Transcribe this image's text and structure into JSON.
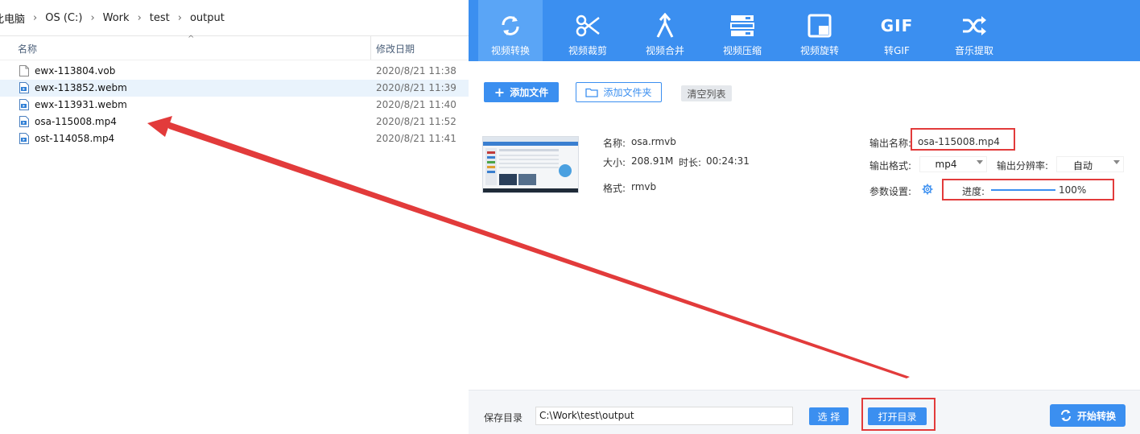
{
  "explorer": {
    "breadcrumb": [
      "此电脑",
      "OS (C:)",
      "Work",
      "test",
      "output"
    ],
    "columns": {
      "name": "名称",
      "date": "修改日期"
    },
    "files": [
      {
        "name": "ewx-113804.vob",
        "date": "2020/8/21 11:38",
        "icon": "generic-file-icon"
      },
      {
        "name": "ewx-113852.webm",
        "date": "2020/8/21 11:39",
        "icon": "video-file-icon"
      },
      {
        "name": "ewx-113931.webm",
        "date": "2020/8/21 11:40",
        "icon": "video-file-icon"
      },
      {
        "name": "osa-115008.mp4",
        "date": "2020/8/21 11:52",
        "icon": "video-file-icon"
      },
      {
        "name": "ost-114058.mp4",
        "date": "2020/8/21 11:41",
        "icon": "video-file-icon"
      }
    ]
  },
  "app": {
    "toolbar": {
      "tools": [
        {
          "label": "视频转换",
          "icon": "convert-icon"
        },
        {
          "label": "视频裁剪",
          "icon": "scissors-icon"
        },
        {
          "label": "视频合并",
          "icon": "merge-icon"
        },
        {
          "label": "视频压缩",
          "icon": "compress-icon"
        },
        {
          "label": "视频旋转",
          "icon": "rotate-icon"
        },
        {
          "label": "转GIF",
          "icon": "gif-icon",
          "icon_text": "GIF"
        },
        {
          "label": "音乐提取",
          "icon": "shuffle-icon"
        }
      ]
    },
    "actions": {
      "add_file": "添加文件",
      "add_folder": "添加文件夹",
      "clear_list": "清空列表"
    },
    "item": {
      "name_label": "名称:",
      "name_value": "osa.rmvb",
      "size_label": "大小:",
      "size_value": "208.91M",
      "duration_label": "时长:",
      "duration_value": "00:24:31",
      "format_label": "格式:",
      "format_value": "rmvb",
      "output_name_label": "输出名称:",
      "output_name_value": "osa-115008.mp4",
      "output_format_label": "输出格式:",
      "output_format_value": "mp4",
      "output_resolution_label": "输出分辨率:",
      "output_resolution_value": "自动",
      "params_label": "参数设置:",
      "progress_label": "进度:",
      "progress_value": "100%",
      "progress_fraction": 1.0
    },
    "footer": {
      "save_dir_label": "保存目录",
      "save_dir_value": "C:\\Work\\test\\output",
      "choose_button": "选 择",
      "open_dir_button": "打开目录",
      "start_button": "开始转换"
    },
    "colors": {
      "accent": "#3b8ff0",
      "annotation": "#e23b3b"
    }
  }
}
